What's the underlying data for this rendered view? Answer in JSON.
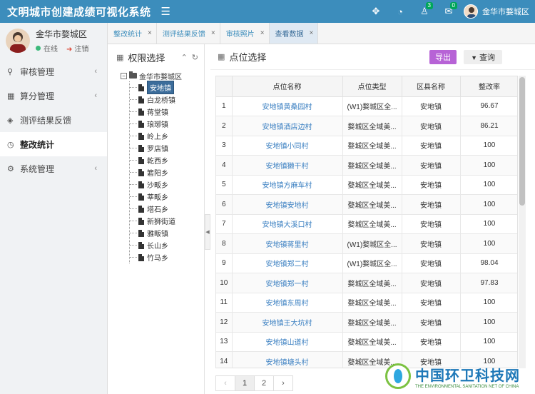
{
  "header": {
    "title": "文明城市创建成绩可视化系统",
    "badges": {
      "users": "3",
      "mail": "0"
    },
    "user_name": "金华市婺城区"
  },
  "sidebar": {
    "user_name": "金华市婺城区",
    "status": "在线",
    "logout": "注销",
    "items": [
      {
        "label": "审核管理",
        "icon": "wrench-icon",
        "chevron": "‹"
      },
      {
        "label": "算分管理",
        "icon": "calculator-icon",
        "chevron": "‹"
      },
      {
        "label": "测评结果反馈",
        "icon": "layers-icon",
        "chevron": ""
      },
      {
        "label": "整改统计",
        "icon": "clock-icon",
        "chevron": ""
      },
      {
        "label": "系统管理",
        "icon": "gear-icon",
        "chevron": "‹"
      }
    ]
  },
  "tabs": [
    {
      "label": "整改统计"
    },
    {
      "label": "测评结果反馈"
    },
    {
      "label": "审核照片"
    },
    {
      "label": "查看数据"
    }
  ],
  "left_panel": {
    "title": "权限选择",
    "root": "金华市婺城区",
    "nodes": [
      "安地镇",
      "白龙桥镇",
      "蒋堂镇",
      "琅琊镇",
      "岭上乡",
      "罗店镇",
      "乾西乡",
      "箬阳乡",
      "沙畈乡",
      "莘畈乡",
      "塔石乡",
      "新狮街道",
      "雅畈镇",
      "长山乡",
      "竹马乡"
    ]
  },
  "main": {
    "title": "点位选择",
    "export_label": "导出",
    "query_label": "查询",
    "columns": [
      "点位名称",
      "点位类型",
      "区县名称",
      "整改率"
    ],
    "rows": [
      {
        "idx": "1",
        "name": "安地镇黄桑园村",
        "type": "(W1)婺城区全...",
        "county": "安地镇",
        "rate": "96.67"
      },
      {
        "idx": "2",
        "name": "安地镇酒店边村",
        "type": "婺城区全域美...",
        "county": "安地镇",
        "rate": "86.21"
      },
      {
        "idx": "3",
        "name": "安地镇小同村",
        "type": "婺城区全域美...",
        "county": "安地镇",
        "rate": "100"
      },
      {
        "idx": "4",
        "name": "安地镇獭干村",
        "type": "婺城区全域美...",
        "county": "安地镇",
        "rate": "100"
      },
      {
        "idx": "5",
        "name": "安地镇方麻车村",
        "type": "婺城区全域美...",
        "county": "安地镇",
        "rate": "100"
      },
      {
        "idx": "6",
        "name": "安地镇安地村",
        "type": "婺城区全域美...",
        "county": "安地镇",
        "rate": "100"
      },
      {
        "idx": "7",
        "name": "安地镇大溪口村",
        "type": "婺城区全域美...",
        "county": "安地镇",
        "rate": "100"
      },
      {
        "idx": "8",
        "name": "安地镇蒋里村",
        "type": "(W1)婺城区全...",
        "county": "安地镇",
        "rate": "100"
      },
      {
        "idx": "9",
        "name": "安地镇郑二村",
        "type": "(W1)婺城区全...",
        "county": "安地镇",
        "rate": "98.04"
      },
      {
        "idx": "10",
        "name": "安地镇郑一村",
        "type": "婺城区全域美...",
        "county": "安地镇",
        "rate": "97.83"
      },
      {
        "idx": "11",
        "name": "安地镇东周村",
        "type": "婺城区全域美...",
        "county": "安地镇",
        "rate": "100"
      },
      {
        "idx": "12",
        "name": "安地镇王大坑村",
        "type": "婺城区全域美...",
        "county": "安地镇",
        "rate": "100"
      },
      {
        "idx": "13",
        "name": "安地镇山道村",
        "type": "婺城区全域美...",
        "county": "安地镇",
        "rate": "100"
      },
      {
        "idx": "14",
        "name": "安地镇塘头村",
        "type": "婺城区全域美...",
        "county": "安地镇",
        "rate": "100"
      }
    ],
    "pager": {
      "prev": "‹",
      "pages": [
        "1",
        "2"
      ],
      "next": "›"
    }
  },
  "watermark": {
    "cn": "中国环卫科技网",
    "en": "THE ENVIRONMENTAL SANITATION NET OF CHINA"
  },
  "colors": {
    "header": "#3c8dbc",
    "export": "#b763d6",
    "link": "#3a7fc1",
    "online": "#3bb97b"
  }
}
